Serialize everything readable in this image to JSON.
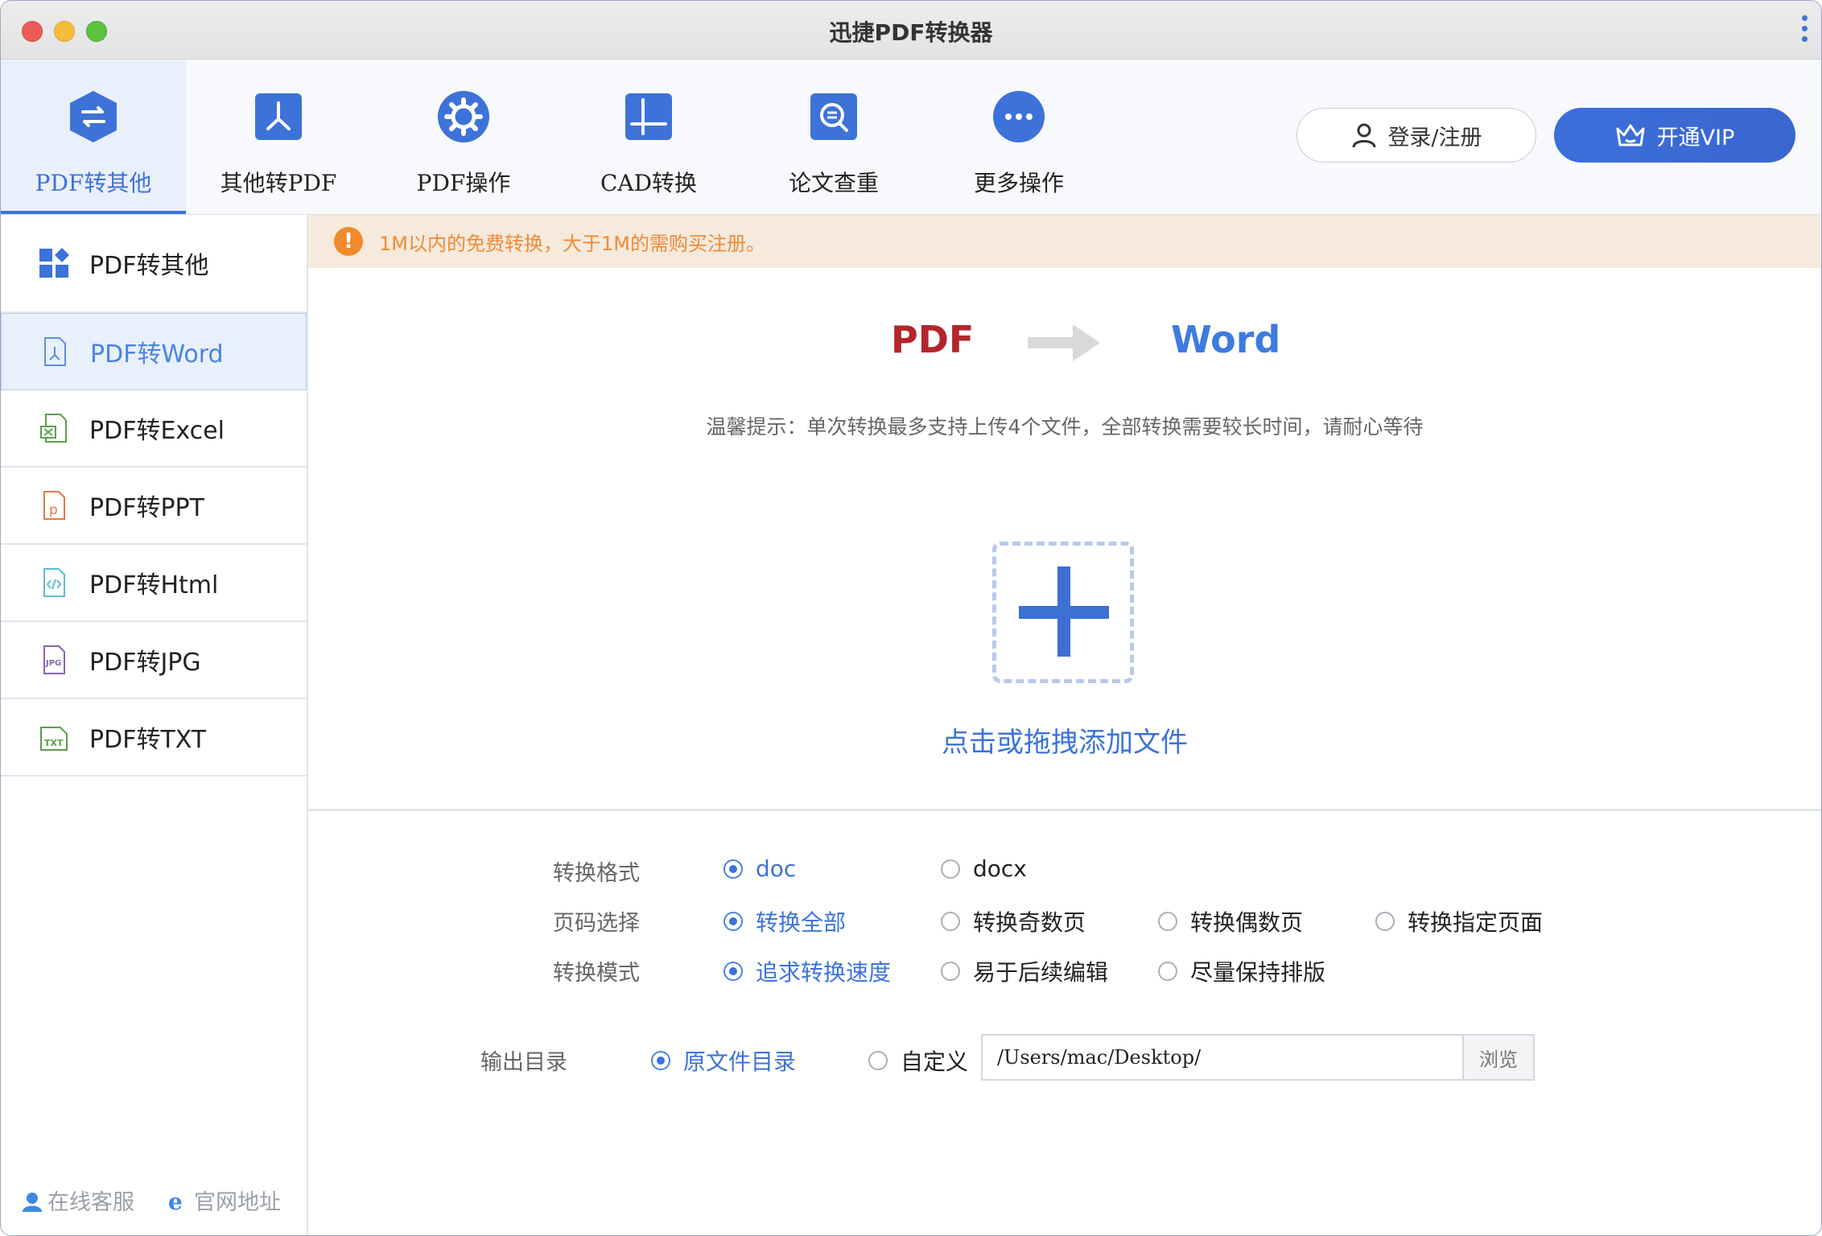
{
  "window": {
    "title": "迅捷PDF转换器"
  },
  "toolbar": {
    "tabs": [
      {
        "label": "PDF转其他",
        "icon": "pdf-convert-icon"
      },
      {
        "label": "其他转PDF",
        "icon": "pdf-logo-icon"
      },
      {
        "label": "PDF操作",
        "icon": "gear-icon"
      },
      {
        "label": "CAD转换",
        "icon": "cad-crosshair-icon"
      },
      {
        "label": "论文查重",
        "icon": "document-search-icon"
      },
      {
        "label": "更多操作",
        "icon": "more-dots-icon"
      }
    ],
    "login_label": "登录/注册",
    "vip_label": "开通VIP"
  },
  "sidebar": {
    "items": [
      {
        "label": "PDF转其他",
        "icon": "category-grid-icon"
      },
      {
        "label": "PDF转Word",
        "icon": "pdf-file-icon"
      },
      {
        "label": "PDF转Excel",
        "icon": "excel-file-icon"
      },
      {
        "label": "PDF转PPT",
        "icon": "ppt-file-icon"
      },
      {
        "label": "PDF转Html",
        "icon": "html-file-icon"
      },
      {
        "label": "PDF转JPG",
        "icon": "jpg-file-icon"
      },
      {
        "label": "PDF转TXT",
        "icon": "txt-file-icon"
      }
    ],
    "footer": {
      "service": "在线客服",
      "website": "官网地址"
    }
  },
  "notice": {
    "text": "1M以内的免费转换，大于1M的需购买注册。"
  },
  "conversion": {
    "from": "PDF",
    "to": "Word"
  },
  "hint": "温馨提示：单次转换最多支持上传4个文件，全部转换需要较长时间，请耐心等待",
  "dropzone": {
    "label": "点击或拖拽添加文件"
  },
  "options": {
    "format": {
      "label": "转换格式",
      "choices": [
        "doc",
        "docx"
      ],
      "selected": "doc"
    },
    "pages": {
      "label": "页码选择",
      "choices": [
        "转换全部",
        "转换奇数页",
        "转换偶数页",
        "转换指定页面"
      ],
      "selected": "转换全部"
    },
    "mode": {
      "label": "转换模式",
      "choices": [
        "追求转换速度",
        "易于后续编辑",
        "尽量保持排版"
      ],
      "selected": "追求转换速度"
    },
    "output": {
      "label": "输出目录",
      "choices": [
        "原文件目录",
        "自定义"
      ],
      "selected": "原文件目录",
      "path": "/Users/mac/Desktop/",
      "browse_label": "浏览"
    }
  },
  "colors": {
    "accent": "#3d72d9",
    "pdf_red": "#b3262b",
    "notice_bg": "#f6eadd",
    "notice_text": "#ef8a35"
  }
}
